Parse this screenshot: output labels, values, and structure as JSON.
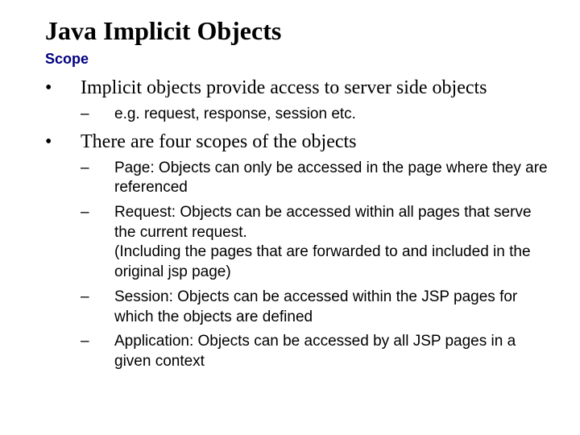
{
  "title": "Java Implicit Objects",
  "subtitle": "Scope",
  "bullets": [
    {
      "text": "Implicit objects provide access to server side objects",
      "sub": [
        {
          "text": "e.g. request, response, session etc."
        }
      ]
    },
    {
      "text": "There are four scopes of the objects",
      "sub": [
        {
          "text": "Page: Objects can only be accessed in the page where they are referenced"
        },
        {
          "text": "Request: Objects can be accessed within all pages that serve the current request.\n(Including the pages that are forwarded to and included in the original jsp page)"
        },
        {
          "text": "Session: Objects can be accessed within the JSP pages for which the objects are defined"
        },
        {
          "text": "Application: Objects can be accessed by all JSP pages in a given context"
        }
      ]
    }
  ]
}
